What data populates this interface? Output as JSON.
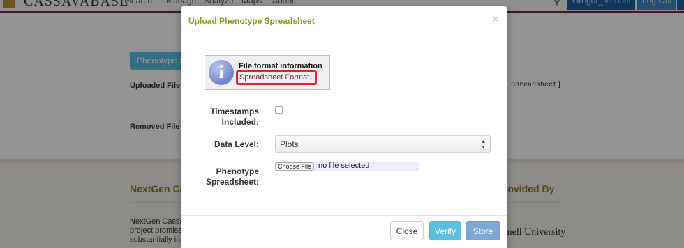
{
  "background": {
    "brand": "CASSAVABASE",
    "nav": [
      "Search",
      "Manage",
      "Analyze",
      "Maps",
      "About"
    ],
    "user": "Gregor_Mendel",
    "logout": "Log Out",
    "phenotype_button": "Phenotype S",
    "uploaded_files_label": "Uploaded File",
    "removed_files_label": "Removed File",
    "spreadsheet_link": "l Spreadsheet]",
    "nextgen_heading": "NextGen Ca",
    "provided_by_heading": "rovided By",
    "body_text": "NextGen Cassa project promise substantially in",
    "cornell": "rnell University"
  },
  "modal": {
    "title": "Upload Phenotype Spreadsheet",
    "close_glyph": "×",
    "info": {
      "icon_glyph": "i",
      "title": "File format information",
      "link": "Spreadsheet Format"
    },
    "form": {
      "timestamps_label": "Timestamps Included:",
      "data_level_label": "Data Level:",
      "data_level_value": "Plots",
      "spreadsheet_label": "Phenotype Spreadsheet:",
      "choose_file_label": "Choose File",
      "file_status": "no file selected"
    },
    "footer": {
      "close_label": "Close",
      "verify_label": "Verify",
      "store_label": "Store"
    }
  },
  "colors": {
    "title": "#8c9a22",
    "highlight": "#e8202a",
    "verify": "#5bc0de",
    "store": "#7fa7d6"
  }
}
